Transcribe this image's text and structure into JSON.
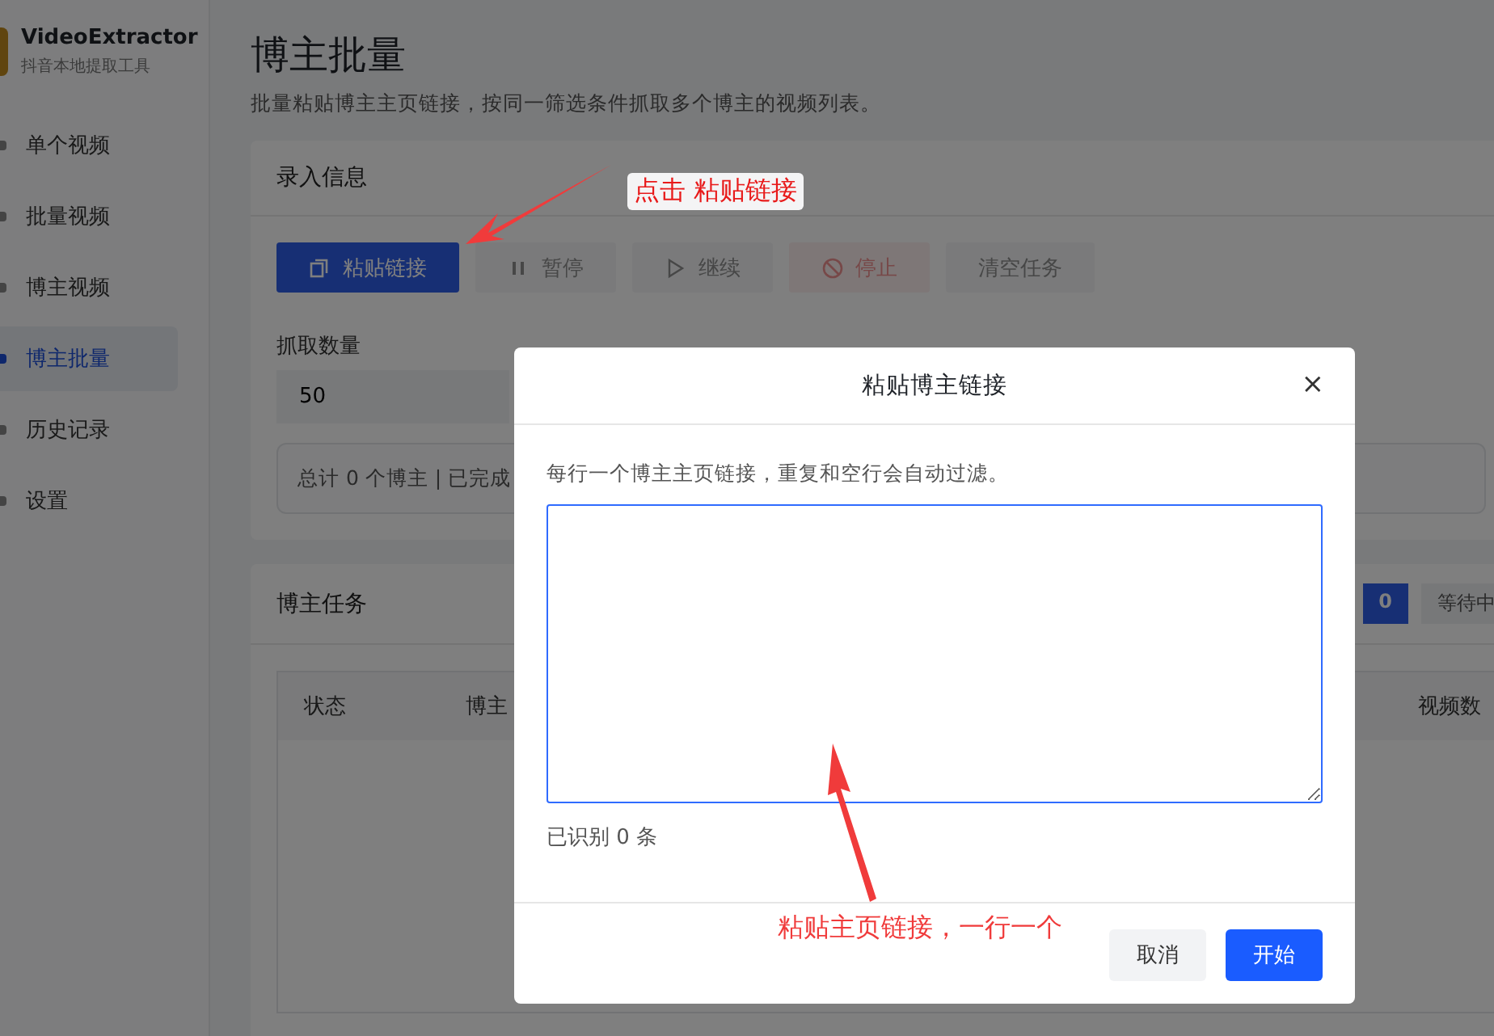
{
  "sidebar": {
    "app_name": "VideoExtractor",
    "app_subtitle": "抖音本地提取工具",
    "items": [
      {
        "label": "单个视频",
        "selected": false
      },
      {
        "label": "批量视频",
        "selected": false
      },
      {
        "label": "博主视频",
        "selected": false
      },
      {
        "label": "博主批量",
        "selected": true
      },
      {
        "label": "历史记录",
        "selected": false
      },
      {
        "label": "设置",
        "selected": false
      }
    ]
  },
  "page": {
    "title": "博主批量",
    "subtitle": "批量粘贴博主主页链接，按同一筛选条件抓取多个博主的视频列表。"
  },
  "input_card": {
    "title": "录入信息",
    "buttons": [
      {
        "label": "粘贴链接",
        "kind": "paste",
        "disabled": false
      },
      {
        "label": "暂停",
        "kind": "pause",
        "disabled": true
      },
      {
        "label": "继续",
        "kind": "resume",
        "disabled": true
      },
      {
        "label": "停止",
        "kind": "stop",
        "disabled": true
      },
      {
        "label": "清空任务",
        "kind": "clear",
        "disabled": true
      }
    ],
    "fields": [
      {
        "label": "抓取数量",
        "value": "50"
      }
    ],
    "summary": "总计 0 个博主 | 已完成"
  },
  "task_card": {
    "title": "博主任务",
    "badges": [
      {
        "label": "0",
        "kind": "primary"
      },
      {
        "label": "等待中",
        "kind": "plain"
      }
    ],
    "table": {
      "columns": [
        "状态",
        "博主",
        "视频数"
      ]
    }
  },
  "dialog": {
    "title": "粘贴博主链接",
    "close": "×",
    "hint": "每行一个博主主页链接，重复和空行会自动过滤。",
    "count": "已识别 0 条",
    "buttons": [
      {
        "label": "取消",
        "kind": "secondary"
      },
      {
        "label": "开始",
        "kind": "primary"
      }
    ]
  },
  "annotations": [
    {
      "text": "点击 粘贴链接",
      "kind": "to-paste-button"
    },
    {
      "text": "粘贴主页链接，一行一个",
      "kind": "to-textarea"
    }
  ]
}
